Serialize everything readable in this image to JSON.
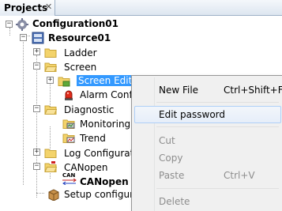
{
  "panel": {
    "title": "Projects",
    "close_glyph": "✕"
  },
  "tree": {
    "root": "Configuration01",
    "resource": "Resource01",
    "ladder": "Ladder",
    "screen": "Screen",
    "screen_editor": "Screen Editor",
    "alarm_config": "Alarm Config",
    "diagnostic": "Diagnostic",
    "monitoring": "Monitoring Va",
    "trend": "Trend",
    "log_config": "Log Configuration",
    "canopen": "CANopen",
    "canopen_item": "CANopen",
    "can_icon_text": "CAN",
    "setup": "Setup configuration"
  },
  "context_menu": {
    "new_file": "New File",
    "new_file_shortcut": "Ctrl+Shift+F",
    "edit_password": "Edit password",
    "cut": "Cut",
    "copy": "Copy",
    "paste": "Paste",
    "paste_shortcut": "Ctrl+V",
    "delete": "Delete"
  },
  "colors": {
    "selection": "#3399ff",
    "folder": "#f3d36b",
    "menu_bg": "#f0f0f0",
    "menu_hover_border": "#aecff7"
  },
  "icons": [
    "gear-icon",
    "resource-icon",
    "folder-icon",
    "screen-editor-icon",
    "alarm-icon",
    "monitor-icon",
    "trend-icon",
    "log-icon",
    "can-icon",
    "package-icon"
  ]
}
